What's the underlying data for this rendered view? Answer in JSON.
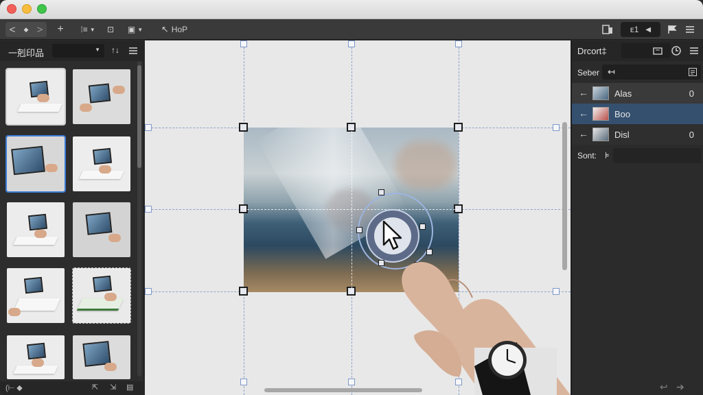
{
  "toolbar": {
    "nav_back": "<",
    "nav_dot": "◆",
    "nav_forward": ">",
    "move_icon": "+",
    "align_icon": "⁞≡",
    "crop_icon": "⊡",
    "layout_icon": "▣",
    "help_label": "HoP",
    "right_index": "ᴇ1"
  },
  "left_panel": {
    "title": "一剋印品",
    "footer_tool": "(⊢ ◆"
  },
  "right_panel": {
    "header_label": "Drcort‡",
    "search_label": "Seber",
    "search_icon_text": "↤",
    "layers": [
      {
        "label": "Alas",
        "count": "0",
        "selected": false
      },
      {
        "label": "Boo",
        "count": "",
        "selected": true
      },
      {
        "label": "Disl",
        "count": "0",
        "selected": false
      }
    ],
    "sort_label": "Sont:",
    "sort_value": "⊧"
  },
  "colors": {
    "accent": "#3b7bd6",
    "selected_row": "#35506f",
    "panel_bg": "#2b2b2b",
    "canvas_bg": "#e8e8e8"
  },
  "icons": {
    "titlebar": [
      "close-button",
      "minimize-button",
      "zoom-button"
    ],
    "toolbar_right": [
      "device-icon",
      "flag-icon",
      "menu-icon"
    ],
    "panel_header": [
      "export-icon",
      "shape-icon",
      "menu-icon"
    ]
  }
}
